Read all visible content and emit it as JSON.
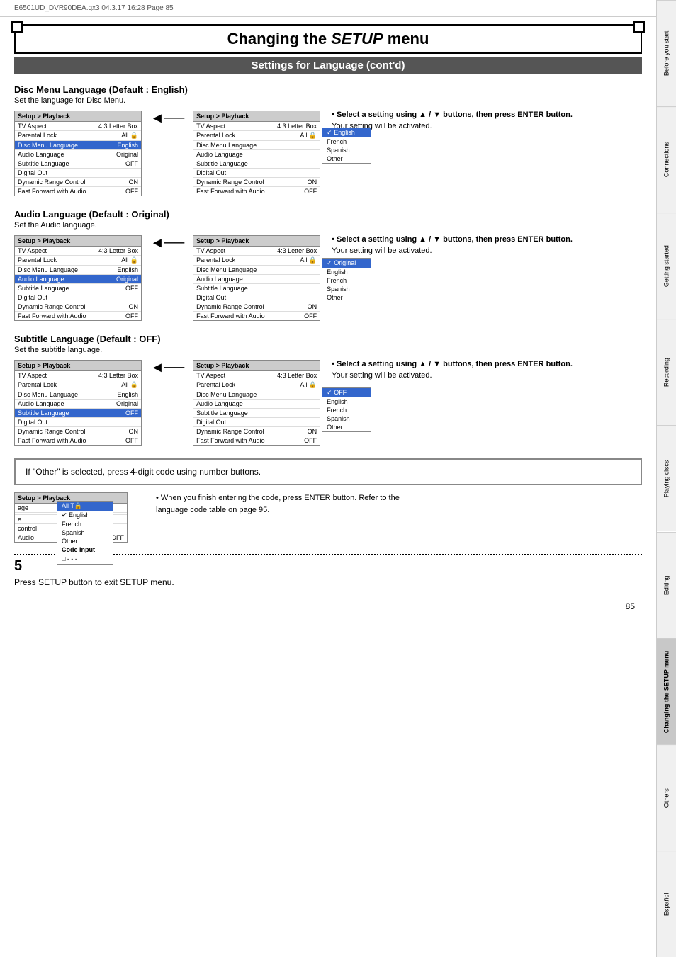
{
  "meta": {
    "file_info": "E6501UD_DVR90DEA.qx3  04.3.17  16:28  Page 85"
  },
  "page_title": "Changing the SETUP menu",
  "page_title_italic": "SETUP",
  "subtitle": "Settings for Language (cont'd)",
  "sections": [
    {
      "id": "disc-menu-language",
      "title": "Disc Menu Language (Default : English)",
      "desc": "Set the language for Disc Menu.",
      "left_menu": {
        "header": "Setup > Playback",
        "rows": [
          {
            "label": "TV Aspect",
            "value": "4:3 Letter Box"
          },
          {
            "label": "Parental Lock",
            "value": "All 🔒"
          },
          {
            "label": "Disc Menu Language",
            "value": "English",
            "highlighted": true
          },
          {
            "label": "Audio Language",
            "value": "Original"
          },
          {
            "label": "Subtitle Language",
            "value": "OFF"
          },
          {
            "label": "Digital Out",
            "value": ""
          },
          {
            "label": "Dynamic Range Control",
            "value": "ON"
          },
          {
            "label": "Fast Forward with Audio",
            "value": "OFF"
          }
        ]
      },
      "right_menu": {
        "header": "Setup > Playback",
        "rows": [
          {
            "label": "TV Aspect",
            "value": "4:3 Letter Box"
          },
          {
            "label": "Parental Lock",
            "value": "All 🔒"
          },
          {
            "label": "Disc Menu Language",
            "value": "",
            "highlighted": true
          },
          {
            "label": "Audio Language",
            "value": ""
          },
          {
            "label": "Subtitle Language",
            "value": ""
          },
          {
            "label": "Digital Out",
            "value": ""
          },
          {
            "label": "Dynamic Range Control",
            "value": "ON"
          },
          {
            "label": "Fast Forward with Audio",
            "value": "OFF"
          }
        ]
      },
      "dropdown": {
        "items": [
          "English",
          "French",
          "Spanish",
          "Other"
        ],
        "selected": "English"
      },
      "dropdown_top_offset": "disc-menu",
      "instruction": {
        "bullet": "Select a setting using ▲ / ▼ buttons, then press ENTER button.",
        "note": "Your setting will be activated."
      }
    },
    {
      "id": "audio-language",
      "title": "Audio Language (Default : Original)",
      "desc": "Set the Audio language.",
      "left_menu": {
        "header": "Setup > Playback",
        "rows": [
          {
            "label": "TV Aspect",
            "value": "4:3 Letter Box"
          },
          {
            "label": "Parental Lock",
            "value": "All 🔒"
          },
          {
            "label": "Disc Menu Language",
            "value": "English"
          },
          {
            "label": "Audio Language",
            "value": "Original",
            "highlighted": true
          },
          {
            "label": "Subtitle Language",
            "value": "OFF"
          },
          {
            "label": "Digital Out",
            "value": ""
          },
          {
            "label": "Dynamic Range Control",
            "value": "ON"
          },
          {
            "label": "Fast Forward with Audio",
            "value": "OFF"
          }
        ]
      },
      "right_menu": {
        "header": "Setup > Playback",
        "rows": [
          {
            "label": "TV Aspect",
            "value": "4:3 Letter Box"
          },
          {
            "label": "Parental Lock",
            "value": "All 🔒"
          },
          {
            "label": "Disc Menu Language",
            "value": ""
          },
          {
            "label": "Audio Language",
            "value": "",
            "highlighted": true
          },
          {
            "label": "Subtitle Language",
            "value": ""
          },
          {
            "label": "Digital Out",
            "value": ""
          },
          {
            "label": "Dynamic Range Control",
            "value": "ON"
          },
          {
            "label": "Fast Forward with Audio",
            "value": "OFF"
          }
        ]
      },
      "dropdown": {
        "items": [
          "Original",
          "English",
          "French",
          "Spanish",
          "Other"
        ],
        "selected": "Original"
      },
      "instruction": {
        "bullet": "Select a setting using ▲ / ▼ buttons, then press ENTER button.",
        "note": "Your setting will be activated."
      }
    },
    {
      "id": "subtitle-language",
      "title": "Subtitle Language (Default : OFF)",
      "desc": "Set the subtitle language.",
      "left_menu": {
        "header": "Setup > Playback",
        "rows": [
          {
            "label": "TV Aspect",
            "value": "4:3 Letter Box"
          },
          {
            "label": "Parental Lock",
            "value": "All 🔒"
          },
          {
            "label": "Disc Menu Language",
            "value": "English"
          },
          {
            "label": "Audio Language",
            "value": "Original"
          },
          {
            "label": "Subtitle Language",
            "value": "OFF",
            "highlighted": true
          },
          {
            "label": "Digital Out",
            "value": ""
          },
          {
            "label": "Dynamic Range Control",
            "value": "ON"
          },
          {
            "label": "Fast Forward with Audio",
            "value": "OFF"
          }
        ]
      },
      "right_menu": {
        "header": "Setup > Playback",
        "rows": [
          {
            "label": "TV Aspect",
            "value": "4:3 Letter Box"
          },
          {
            "label": "Parental Lock",
            "value": "All 🔒"
          },
          {
            "label": "Disc Menu Language",
            "value": ""
          },
          {
            "label": "Audio Language",
            "value": ""
          },
          {
            "label": "Subtitle Language",
            "value": "",
            "highlighted": true
          },
          {
            "label": "Digital Out",
            "value": ""
          },
          {
            "label": "Dynamic Range Control",
            "value": "ON"
          },
          {
            "label": "Fast Forward with Audio",
            "value": "OFF"
          }
        ]
      },
      "dropdown": {
        "items": [
          "OFF",
          "English",
          "French",
          "Spanish",
          "Other"
        ],
        "selected": "OFF"
      },
      "instruction": {
        "bullet": "Select a setting using ▲ / ▼ buttons, then press ENTER button.",
        "note": "Your setting will be activated."
      }
    }
  ],
  "other_box": {
    "text": "If \"Other\" is selected, press 4-digit code using number buttons."
  },
  "code_demo": {
    "menu_header": "Setup > Playback",
    "rows": [
      {
        "label": "age",
        "value": ""
      },
      {
        "label": "",
        "value": ""
      },
      {
        "label": "e",
        "value": ""
      },
      {
        "label": "control",
        "value": ""
      },
      {
        "label": "Audio",
        "value": "OFF"
      }
    ],
    "dropdown_items": [
      "All  T🔒",
      "✓ English",
      "French",
      "Spanish",
      "Other",
      "Code Input",
      "□ - - -"
    ],
    "instruction_bold": "When you finish entering the code, press ENTER button. Refer to the language code table on page 95."
  },
  "step5": {
    "number": "5",
    "text": "Press SETUP button to exit SETUP menu."
  },
  "page_number": "85",
  "sidebar_tabs": [
    {
      "label": "Before you start",
      "active": false
    },
    {
      "label": "Connections",
      "active": false
    },
    {
      "label": "Getting started",
      "active": false
    },
    {
      "label": "Recording",
      "active": false
    },
    {
      "label": "Playing discs",
      "active": false
    },
    {
      "label": "Editing",
      "active": false
    },
    {
      "label": "Changing the SETUP menu",
      "active": true
    },
    {
      "label": "Others",
      "active": false
    },
    {
      "label": "Español",
      "active": false
    }
  ]
}
